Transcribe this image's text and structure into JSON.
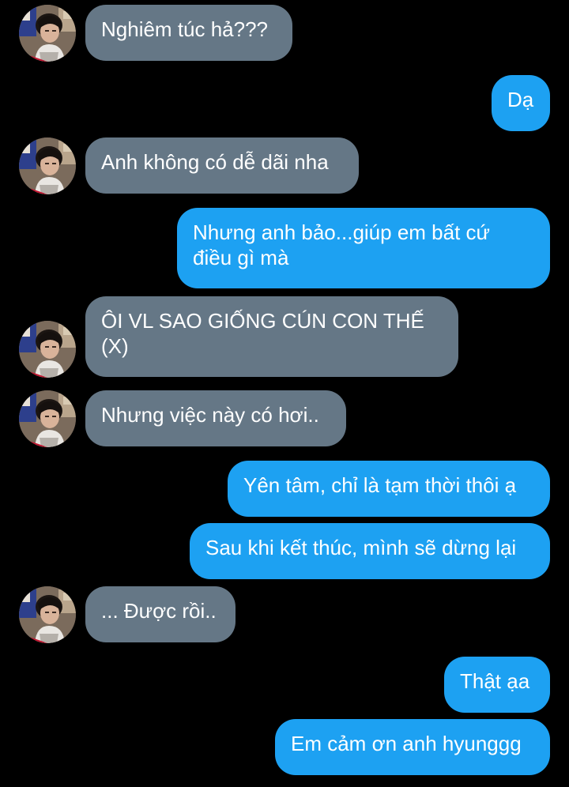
{
  "colors": {
    "background": "#000000",
    "incoming_bubble": "#657786",
    "outgoing_bubble": "#1da1f2",
    "text": "#ffffff"
  },
  "contact": {
    "avatar_icon": "profile-photo"
  },
  "messages": [
    {
      "sender": "them",
      "text": "Nghiêm túc hả???"
    },
    {
      "sender": "me",
      "text": "Dạ"
    },
    {
      "sender": "them",
      "text": "Anh không có dễ dãi nha"
    },
    {
      "sender": "me",
      "text": "Nhưng anh bảo...giúp em bất cứ điều gì mà"
    },
    {
      "sender": "them",
      "text": "ÔI VL SAO GIỐNG CÚN CON THẾ (X)"
    },
    {
      "sender": "them",
      "text": "Nhưng việc này có hơi.."
    },
    {
      "sender": "me",
      "text": "Yên tâm, chỉ là tạm thời thôi ạ"
    },
    {
      "sender": "me",
      "text": "Sau khi kết thúc, mình sẽ dừng lại"
    },
    {
      "sender": "them",
      "text": "... Được rồi.."
    },
    {
      "sender": "me",
      "text": "Thật ạa"
    },
    {
      "sender": "me",
      "text": "Em cảm ơn anh hyunggg"
    }
  ]
}
